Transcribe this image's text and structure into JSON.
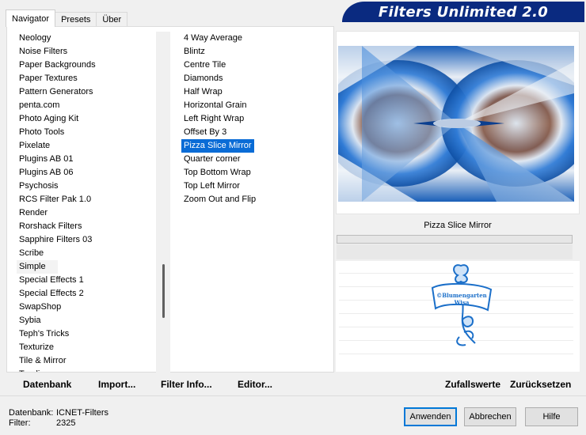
{
  "banner": {
    "title": "Filters Unlimited 2.0"
  },
  "tabs": [
    {
      "label": "Navigator",
      "active": true
    },
    {
      "label": "Presets",
      "active": false
    },
    {
      "label": "Über",
      "active": false
    }
  ],
  "categories": [
    "Neology",
    "Noise Filters",
    "Paper Backgrounds",
    "Paper Textures",
    "Pattern Generators",
    "penta.com",
    "Photo Aging Kit",
    "Photo Tools",
    "Pixelate",
    "Plugins AB 01",
    "Plugins AB 06",
    "Psychosis",
    "RCS Filter Pak 1.0",
    "Render",
    "Rorshack Filters",
    "Sapphire Filters 03",
    "Scribe",
    "Simple",
    "Special Effects 1",
    "Special Effects 2",
    "SwapShop",
    "Sybia",
    "Teph's Tricks",
    "Texturize",
    "Tile & Mirror",
    "Toadies"
  ],
  "categories_hover_index": 17,
  "filters": [
    "4 Way Average",
    "Blintz",
    "Centre Tile",
    "Diamonds",
    "Half Wrap",
    "Horizontal Grain",
    "Left Right Wrap",
    "Offset By 3",
    "Pizza Slice Mirror",
    "Quarter corner",
    "Top Bottom Wrap",
    "Top Left Mirror",
    "Zoom Out and Flip"
  ],
  "filters_selected_index": 8,
  "preview": {
    "filter_name": "Pizza Slice Mirror"
  },
  "logo": {
    "line1": "©Blumengarten",
    "line2": "Wisa"
  },
  "left_buttons": {
    "datenbank": "Datenbank",
    "import": "Import...",
    "filter_info": "Filter Info...",
    "editor": "Editor..."
  },
  "right_buttons": {
    "random": "Zufallswerte",
    "reset": "Zurücksetzen"
  },
  "status": {
    "db_label": "Datenbank:",
    "db_value": "ICNET-Filters",
    "filter_label": "Filter:",
    "filter_value": "2325"
  },
  "dialog_buttons": {
    "apply": "Anwenden",
    "cancel": "Abbrechen",
    "help": "Hilfe"
  },
  "colors": {
    "banner": "#0a2a80",
    "selection": "#0a6cd6",
    "logo_blue": "#1b6fc9"
  }
}
